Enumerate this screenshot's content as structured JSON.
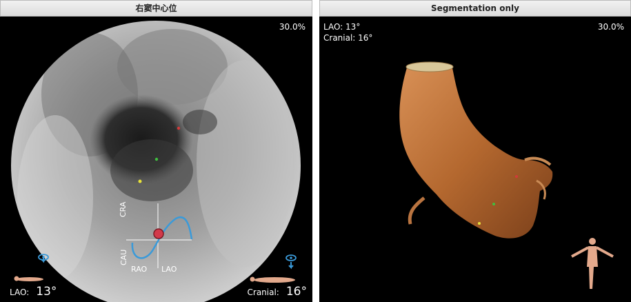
{
  "left_view": {
    "title": "右窦中心位",
    "zoom": "30.0%",
    "gizmo": {
      "cra": "CRA",
      "cau": "CAU",
      "rao": "RAO",
      "lao": "LAO"
    },
    "angle_left_label": "LAO:",
    "angle_left_value": "13°",
    "angle_right_label": "Cranial:",
    "angle_right_value": "16°"
  },
  "right_view": {
    "title": "Segmentation only",
    "zoom": "30.0%",
    "lao_text": "LAO: 13°",
    "cranial_text": "Cranial: 16°"
  },
  "colors": {
    "accent": "#3a9ad9",
    "marker_red": "#d23a3a",
    "marker_green": "#3fbf3f",
    "marker_yellow": "#e8e23a",
    "aorta": "#c9773f"
  },
  "icons": [
    "eye-icon",
    "arrow-down-icon",
    "body-figure-icon"
  ]
}
